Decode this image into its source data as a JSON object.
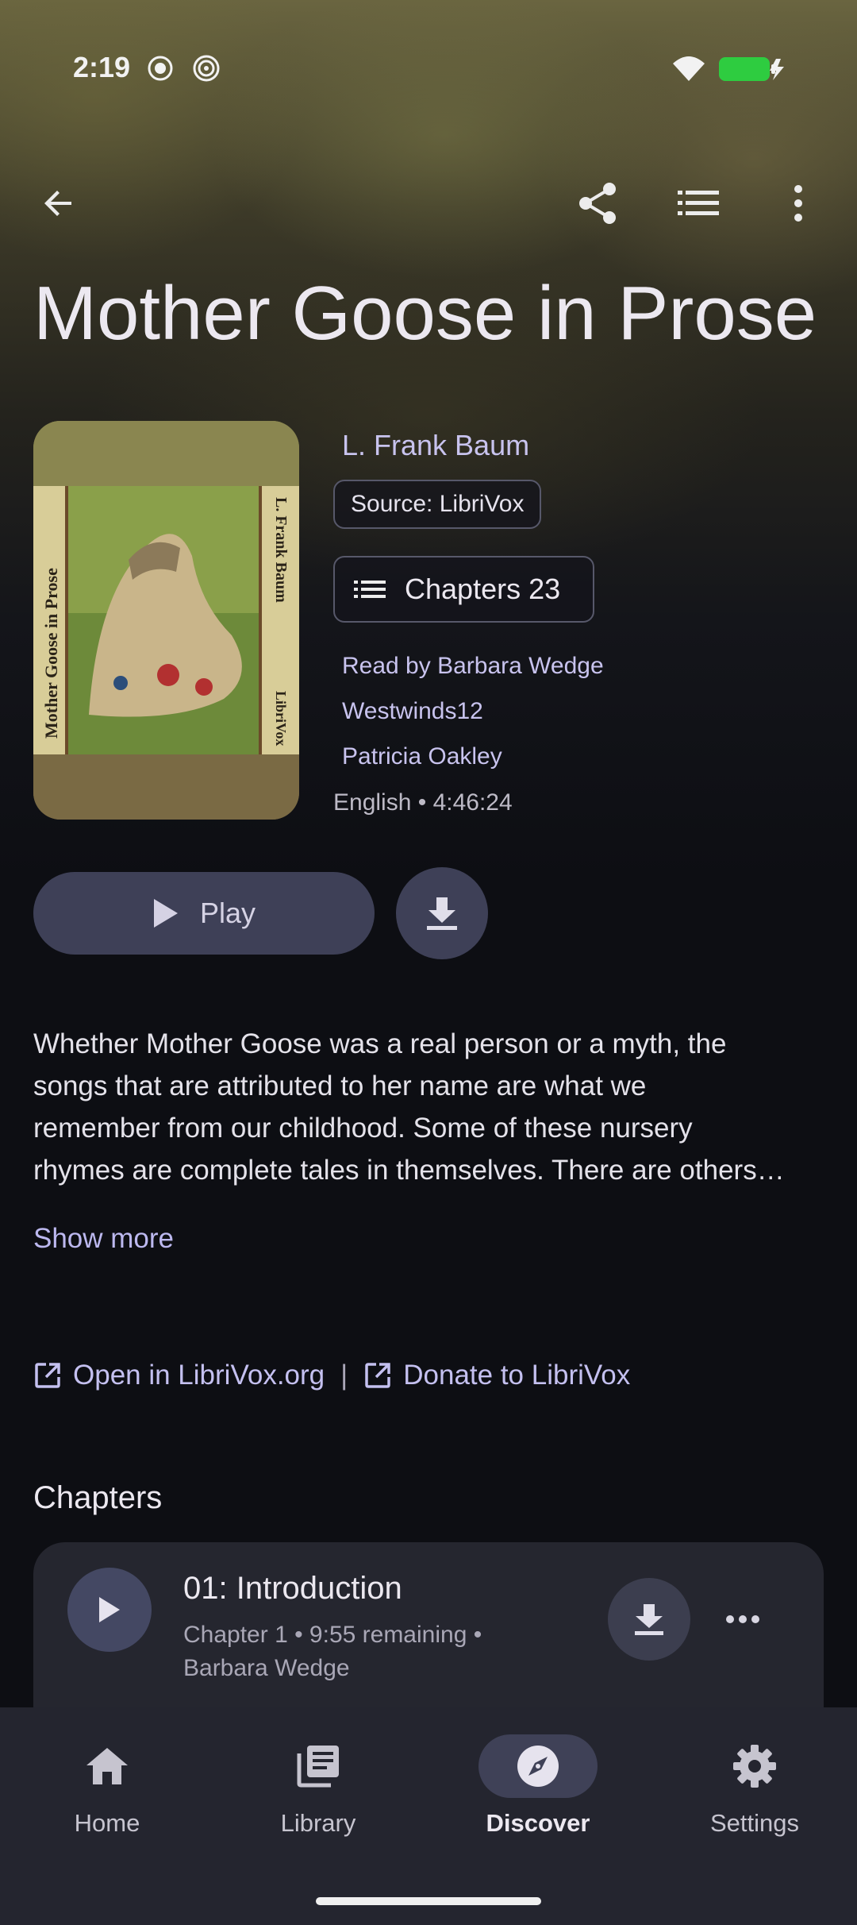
{
  "status_bar": {
    "time": "2:19"
  },
  "book": {
    "title": "Mother Goose in Prose",
    "author": "L. Frank Baum",
    "source": "Source: LibriVox",
    "chapters_label": "Chapters 23",
    "readers": [
      "Read by Barbara Wedge",
      "Westwinds12",
      "Patricia Oakley"
    ],
    "language_duration": "English • 4:46:24",
    "cover_title": "Mother Goose in Prose",
    "cover_author": "L. Frank Baum",
    "cover_publisher": "LibriVox"
  },
  "actions": {
    "play_label": "Play"
  },
  "description": {
    "lines": [
      "Whether Mother Goose was a real person or a myth, the",
      "songs that are attributed to her name are what we",
      "remember from our childhood. Some of these nursery",
      "rhymes are complete tales in themselves. There are others…"
    ],
    "show_more": "Show more"
  },
  "links": {
    "open": "Open in LibriVox.org",
    "separator": "|",
    "donate": "Donate to LibriVox"
  },
  "chapters_section": {
    "title": "Chapters",
    "items": [
      {
        "title": "01: Introduction",
        "sub1": "Chapter 1 • 9:55 remaining •",
        "sub2": "Barbara Wedge"
      }
    ]
  },
  "nav": {
    "items": [
      {
        "label": "Home",
        "icon": "home-icon"
      },
      {
        "label": "Library",
        "icon": "library-icon"
      },
      {
        "label": "Discover",
        "icon": "compass-icon",
        "active": true
      },
      {
        "label": "Settings",
        "icon": "gear-icon"
      }
    ]
  },
  "colors": {
    "accent": "#c4c0f0",
    "surface": "#25262f",
    "nav_bg": "#24252f",
    "battery": "#2ecc40"
  }
}
